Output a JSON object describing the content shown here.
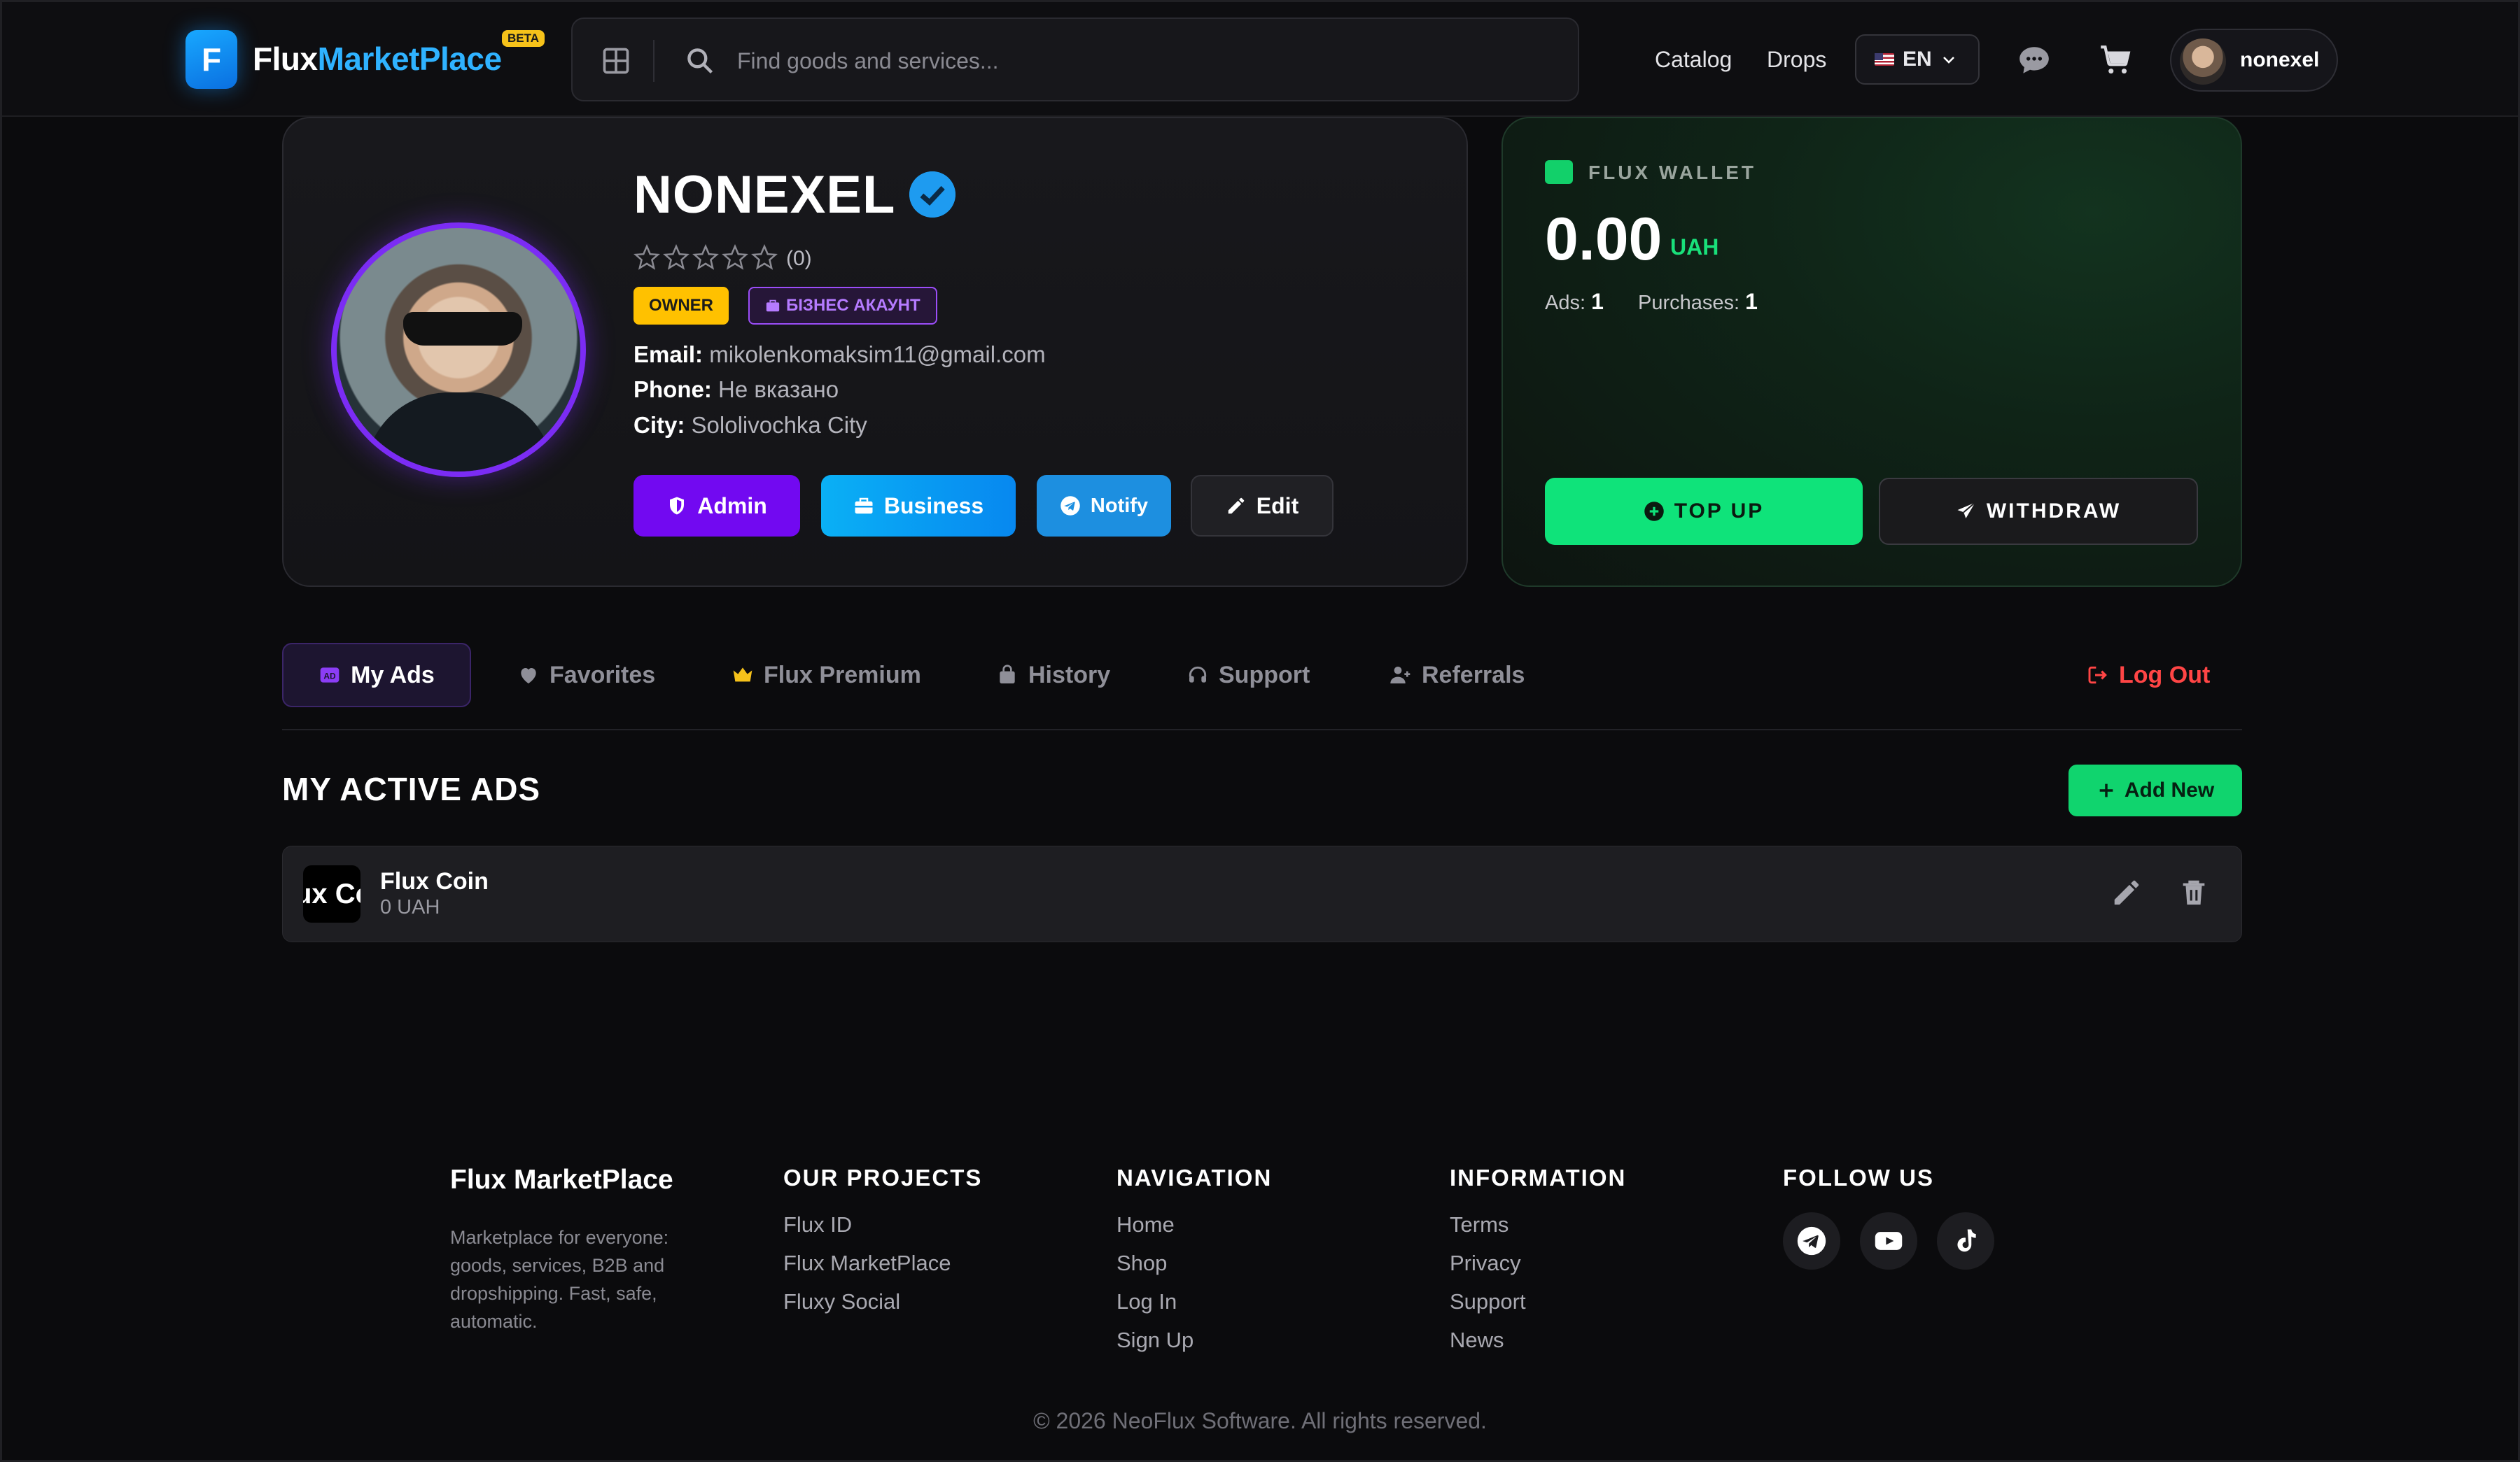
{
  "header": {
    "logo_letter": "F",
    "logo_part1": "Flux",
    "logo_part2": "MarketPlace",
    "beta": "BETA",
    "search_placeholder": "Find goods and services...",
    "nav": [
      "Catalog",
      "Drops"
    ],
    "language": "EN",
    "username": "nonexel"
  },
  "profile": {
    "name": "NONEXEL",
    "rating_count": "(0)",
    "rating_stars": 0,
    "badges": {
      "owner": "OWNER",
      "business": "БІЗНЕС АКАУНТ"
    },
    "email_label": "Email:",
    "email": "mikolenkomaksim11@gmail.com",
    "phone_label": "Phone:",
    "phone": "Не вказано",
    "city_label": "City:",
    "city": "Sololivochka City",
    "buttons": {
      "admin": "Admin",
      "business": "Business",
      "notify": "Notify",
      "edit": "Edit"
    }
  },
  "wallet": {
    "label": "FLUX WALLET",
    "balance": "0.00",
    "currency": "UAH",
    "ads_label": "Ads:",
    "ads_value": "1",
    "purchases_label": "Purchases:",
    "purchases_value": "1",
    "topup": "TOP UP",
    "withdraw": "WITHDRAW"
  },
  "tabs": {
    "my_ads": "My Ads",
    "favorites": "Favorites",
    "premium": "Flux Premium",
    "history": "History",
    "support": "Support",
    "referrals": "Referrals",
    "logout": "Log Out"
  },
  "ads": {
    "title": "MY ACTIVE ADS",
    "add_new": "Add New",
    "items": [
      {
        "thumb_text": "ux Co",
        "title": "Flux Coin",
        "price": "0 UAH"
      }
    ]
  },
  "footer": {
    "brand": "Flux MarketPlace",
    "description": "Marketplace for everyone: goods, services, B2B and dropshipping. Fast, safe, automatic.",
    "projects_title": "OUR PROJECTS",
    "projects": [
      "Flux ID",
      "Flux MarketPlace",
      "Fluxy Social"
    ],
    "navigation_title": "NAVIGATION",
    "navigation": [
      "Home",
      "Shop",
      "Log In",
      "Sign Up"
    ],
    "information_title": "INFORMATION",
    "information": [
      "Terms",
      "Privacy",
      "Support",
      "News"
    ],
    "follow_title": "FOLLOW US",
    "socials": [
      "telegram-icon",
      "youtube-icon",
      "tiktok-icon"
    ],
    "copyright": "© 2026 NeoFlux Software. All rights reserved."
  },
  "colors": {
    "accent_blue": "#2fb2ff",
    "admin_purple": "#7b2cf4",
    "wallet_green": "#0fe37a",
    "owner_yellow": "#ffc100",
    "logout_red": "#ff4545"
  }
}
